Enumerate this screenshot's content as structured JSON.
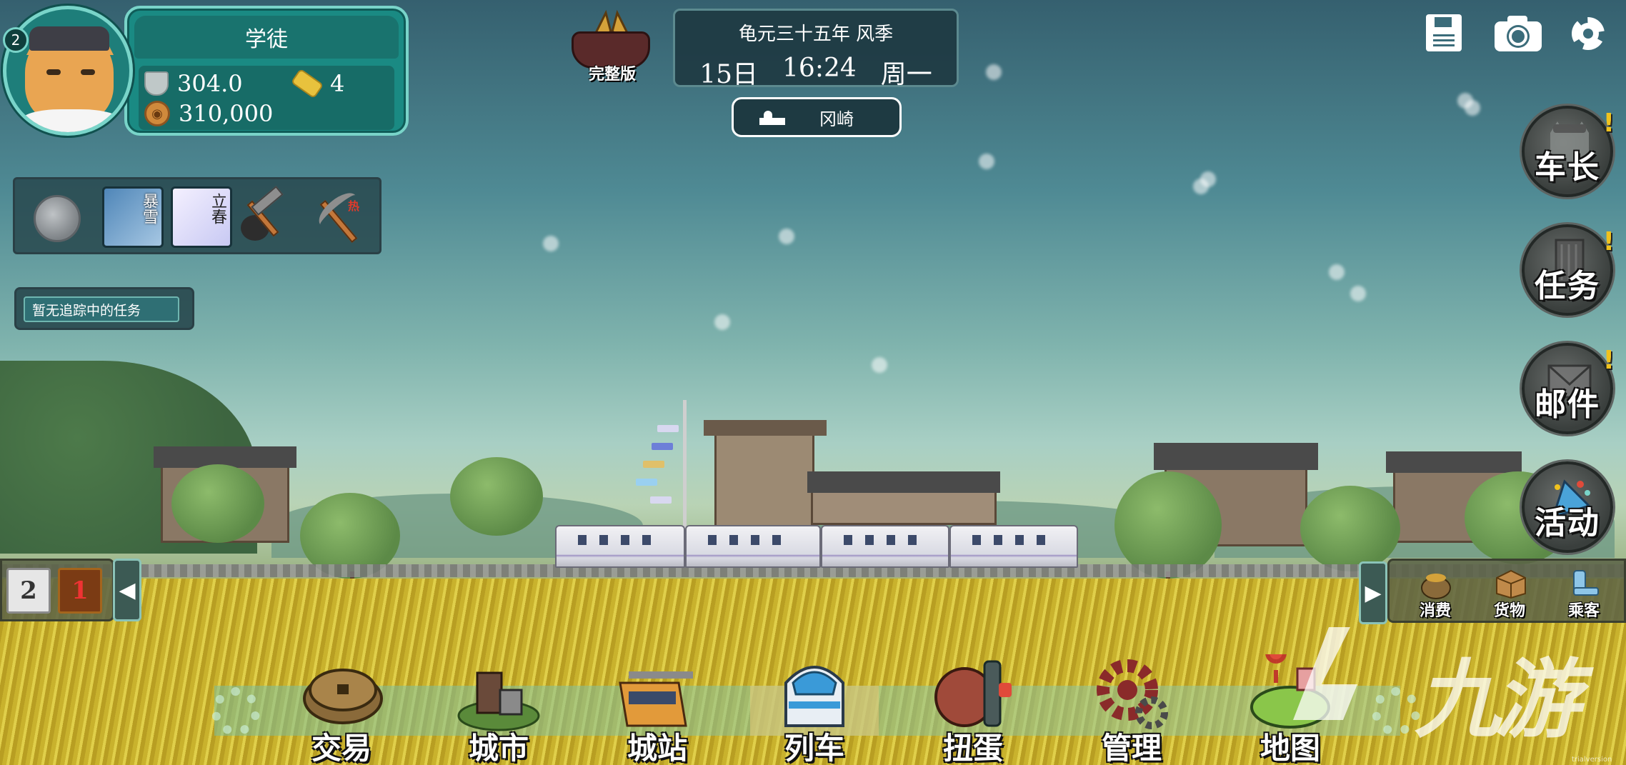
{
  "player": {
    "level": "2",
    "rank_title": "学徒",
    "score": "304.0",
    "tickets": "4",
    "money": "310,000"
  },
  "weather_cards": [
    {
      "label": "暴雪"
    },
    {
      "label": "立春"
    }
  ],
  "tools": {
    "hot_mark": "热"
  },
  "quest": {
    "tracker_text": "暂无追踪中的任务"
  },
  "edition": {
    "label": "完整版"
  },
  "date": {
    "era_line": "龟元三十五年 风季",
    "day": "15日",
    "time": "16:24",
    "weekday": "周一"
  },
  "location": {
    "name": "冈崎"
  },
  "top_icons": [
    "save-icon",
    "camera-icon",
    "gear-icon"
  ],
  "side_buttons": [
    {
      "label": "车长",
      "alert": "!"
    },
    {
      "label": "任务",
      "alert": "!"
    },
    {
      "label": "邮件",
      "alert": "!"
    },
    {
      "label": "活动"
    }
  ],
  "page_tabs": {
    "page_a": "2",
    "page_b": "1",
    "left_arrow": "◀",
    "right_arrow": "▶"
  },
  "tray": [
    {
      "label": "消费"
    },
    {
      "label": "货物"
    },
    {
      "label": "乘客"
    }
  ],
  "bottom_menu": [
    {
      "label": "交易"
    },
    {
      "label": "城市"
    },
    {
      "label": "城站"
    },
    {
      "label": "列车",
      "active": true
    },
    {
      "label": "扭蛋"
    },
    {
      "label": "管理"
    },
    {
      "label": "地图"
    }
  ],
  "watermark": {
    "text": "九游",
    "small": "trialversion"
  },
  "colors": {
    "panel_teal": "#1a8a83",
    "panel_border": "#79d4c9",
    "alert_yellow": "#f0c21e"
  }
}
